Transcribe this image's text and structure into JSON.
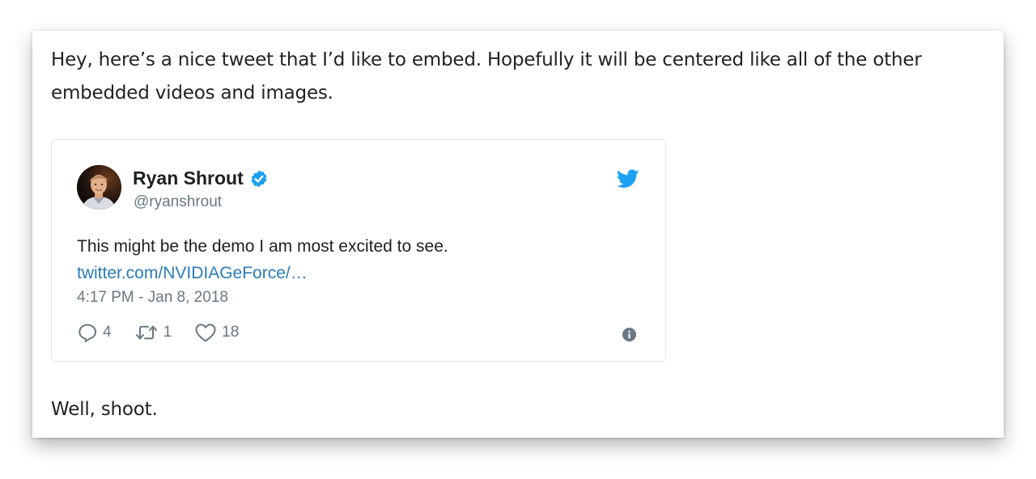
{
  "article": {
    "intro": "Hey, here’s a nice tweet that I’d like to embed. Hopefully it will be centered like all of the other embedded videos and images.",
    "outro": "Well, shoot."
  },
  "tweet": {
    "author_name": "Ryan Shrout",
    "author_handle": "@ryanshrout",
    "text": "This might be the demo I am most excited to see.",
    "link_text": "twitter.com/NVIDIAGeForce/…",
    "timestamp": "4:17 PM - Jan 8, 2018",
    "reply_count": "4",
    "retweet_count": "1",
    "like_count": "18",
    "icons": {
      "verified": "verified-badge-icon",
      "brand": "twitter-bird-icon",
      "reply": "reply-icon",
      "retweet": "retweet-icon",
      "like": "heart-icon",
      "info": "info-icon"
    },
    "colors": {
      "twitter_blue": "#1da1f2",
      "link": "#2b7bb9",
      "muted_text": "#697882",
      "body_text": "#1c2022",
      "border": "#e1e8ed"
    }
  }
}
